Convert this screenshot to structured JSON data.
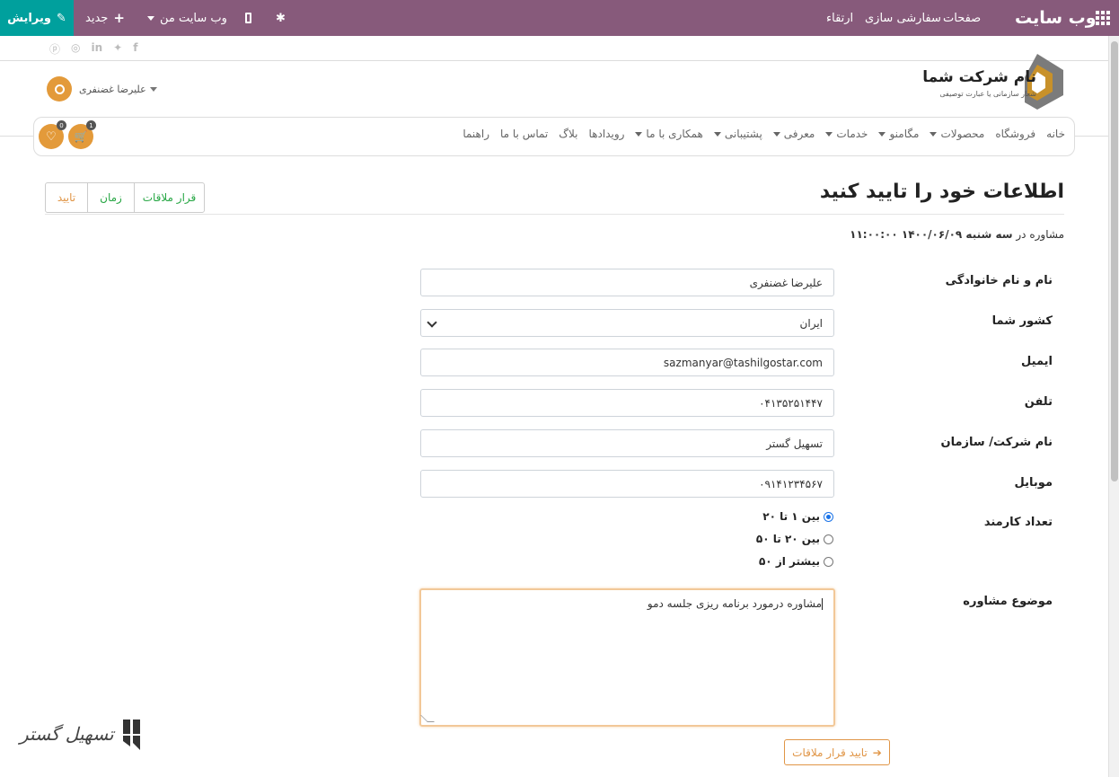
{
  "topbar": {
    "brand": "وب سایت",
    "pages": "صفحات",
    "customize": "سفارشی سازی",
    "upgrade": "ارتقاء",
    "my_website": "وب سایت من",
    "new": "جدید",
    "edit": "ویرایش"
  },
  "colors": {
    "admin_bar": "#875a7b",
    "edit_button": "#00a09d",
    "accent": "#e09546",
    "success": "#28a745"
  },
  "header": {
    "user_name": "علیرضا غضنفری",
    "logo_title": "نام شرکت شما",
    "logo_tagline": "شعار سازمانی یا عبارت توصیفی",
    "cart_count": "1",
    "wishlist_count": "0"
  },
  "nav": {
    "items": [
      {
        "label": "خانه",
        "dropdown": false
      },
      {
        "label": "فروشگاه",
        "dropdown": false
      },
      {
        "label": "محصولات",
        "dropdown": true
      },
      {
        "label": "مگامنو",
        "dropdown": true
      },
      {
        "label": "خدمات",
        "dropdown": true
      },
      {
        "label": "معرفی",
        "dropdown": true
      },
      {
        "label": "پشتیبانی",
        "dropdown": true
      },
      {
        "label": "همکاری با ما",
        "dropdown": true
      },
      {
        "label": "رویدادها",
        "dropdown": false
      },
      {
        "label": "بلاگ",
        "dropdown": false
      },
      {
        "label": "تماس با ما",
        "dropdown": false
      },
      {
        "label": "راهنما",
        "dropdown": false
      }
    ]
  },
  "page": {
    "title": "اطلاعات خود را تایید کنید",
    "subtitle_prefix": "مشاوره در",
    "subtitle_date": "سه شنبه ۱۴۰۰/۰۶/۰۹ ۱۱:۰۰:۰۰"
  },
  "steps": {
    "meeting": "قرار ملاقات",
    "time": "زمان",
    "confirm": "تایید"
  },
  "form": {
    "name_label": "نام و نام خانوادگی",
    "name_value": "علیرضا غضنفری",
    "country_label": "کشور شما",
    "country_value": "ایران",
    "email_label": "ایمیل",
    "email_value": "sazmanyar@tashilgostar.com",
    "phone_label": "تلفن",
    "phone_value": "۰۴۱۳۵۲۵۱۴۴۷",
    "company_label": "نام شرکت/ سازمان",
    "company_value": "تسهیل گستر",
    "mobile_label": "موبایل",
    "mobile_value": "۰۹۱۴۱۲۳۴۵۶۷",
    "employees_label": "تعداد کارمند",
    "employee_options": [
      "بین ۱ تا ۲۰",
      "بین ۲۰ تا ۵۰",
      "بیشتر از ۵۰"
    ],
    "employees_selected": 0,
    "topic_label": "موضوع مشاوره",
    "topic_value": "مشاوره درمورد برنامه ریزی جلسه دمو",
    "submit": "تایید قرار ملاقات"
  },
  "watermark": {
    "text": "تسهیل گستر"
  }
}
